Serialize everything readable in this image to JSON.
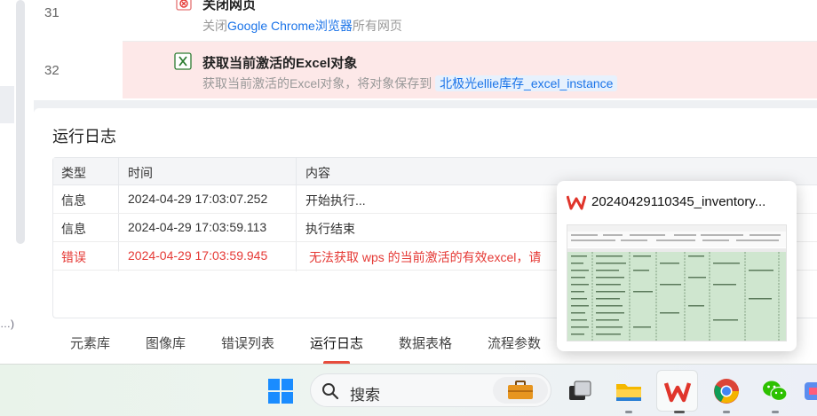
{
  "sidebar": {
    "truncated_text": "…)"
  },
  "flow": {
    "rows": [
      {
        "num": "31",
        "title": "关闭网页",
        "desc_prefix": "关闭",
        "desc_highlight": "Google Chrome浏览器",
        "desc_suffix": "所有网页"
      },
      {
        "num": "32",
        "title": "获取当前激活的Excel对象",
        "desc_prefix": "获取当前激活的Excel对象，将对象保存到",
        "variable": "北极光ellie库存_excel_instance"
      }
    ]
  },
  "log": {
    "title": "运行日志",
    "columns": [
      "类型",
      "时间",
      "内容"
    ],
    "rows": [
      {
        "type": "信息",
        "time": "2024-04-29 17:03:07.252",
        "content": "开始执行...",
        "level": "info"
      },
      {
        "type": "信息",
        "time": "2024-04-29 17:03:59.113",
        "content": "执行结束",
        "level": "info"
      },
      {
        "type": "错误",
        "time": "2024-04-29 17:03:59.945",
        "content": "无法获取 wps 的当前激活的有效excel，请",
        "level": "error"
      }
    ]
  },
  "tabs": [
    {
      "label": "元素库",
      "active": false
    },
    {
      "label": "图像库",
      "active": false
    },
    {
      "label": "错误列表",
      "active": false
    },
    {
      "label": "运行日志",
      "active": true
    },
    {
      "label": "数据表格",
      "active": false
    },
    {
      "label": "流程参数",
      "active": false
    }
  ],
  "preview": {
    "title": "20240429110345_inventory..."
  },
  "taskbar": {
    "search_placeholder": "搜索",
    "icons": [
      "windows-start-icon",
      "search-icon",
      "briefcase-icon",
      "task-view-icon",
      "file-explorer-icon",
      "wps-icon",
      "chrome-icon",
      "wechat-icon",
      "app-icon"
    ]
  },
  "colors": {
    "error": "#e53935",
    "link": "#1a73e8",
    "selected_row": "#fde8e8",
    "tab_indicator": "#e74c3c",
    "wps_red": "#e0352b"
  }
}
